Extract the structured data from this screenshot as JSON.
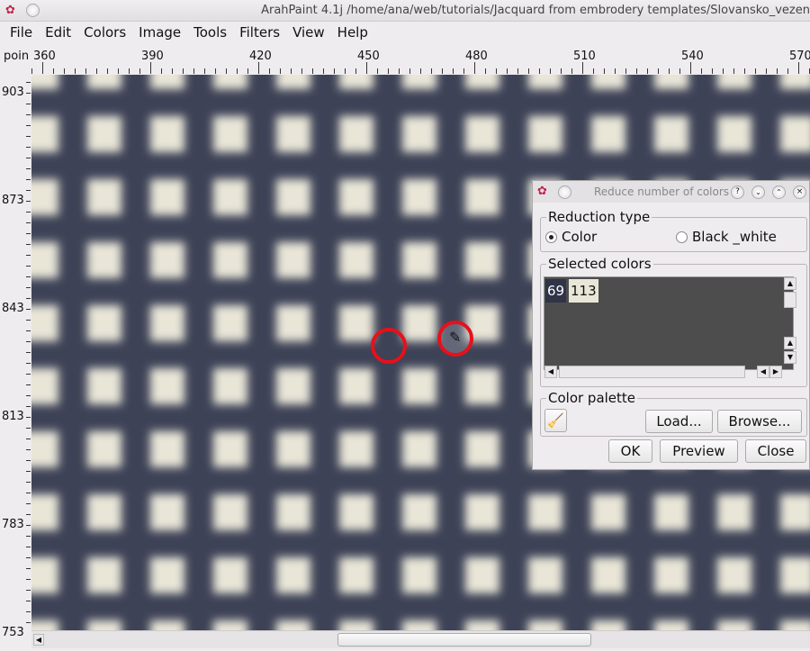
{
  "window": {
    "title": "ArahPaint 4.1j /home/ana/web/tutorials/Jacquard from embrodery templates/Slovansko_vezen"
  },
  "menu": [
    "File",
    "Edit",
    "Colors",
    "Image",
    "Tools",
    "Filters",
    "View",
    "Help"
  ],
  "ruler": {
    "unit_label": "poin",
    "h_labels": [
      "360",
      "390",
      "420",
      "450",
      "480",
      "510",
      "540",
      "570"
    ],
    "v_labels": [
      "903",
      "873",
      "843",
      "813",
      "783",
      "753"
    ]
  },
  "dialog": {
    "title": "Reduce number of colors",
    "reduction_type": {
      "label": "Reduction type",
      "options": [
        "Color",
        "Black _white"
      ],
      "selected": "Color"
    },
    "selected_colors": {
      "label": "Selected colors",
      "items": [
        {
          "value": "69",
          "color": "#2f3447",
          "text_color": "#ffffff"
        },
        {
          "value": "113",
          "color": "#e9e6d8",
          "text_color": "#111111"
        }
      ]
    },
    "palette": {
      "label": "Color palette",
      "load": "Load...",
      "browse": "Browse..."
    },
    "ok": "OK",
    "preview": "Preview",
    "close": "Close"
  }
}
